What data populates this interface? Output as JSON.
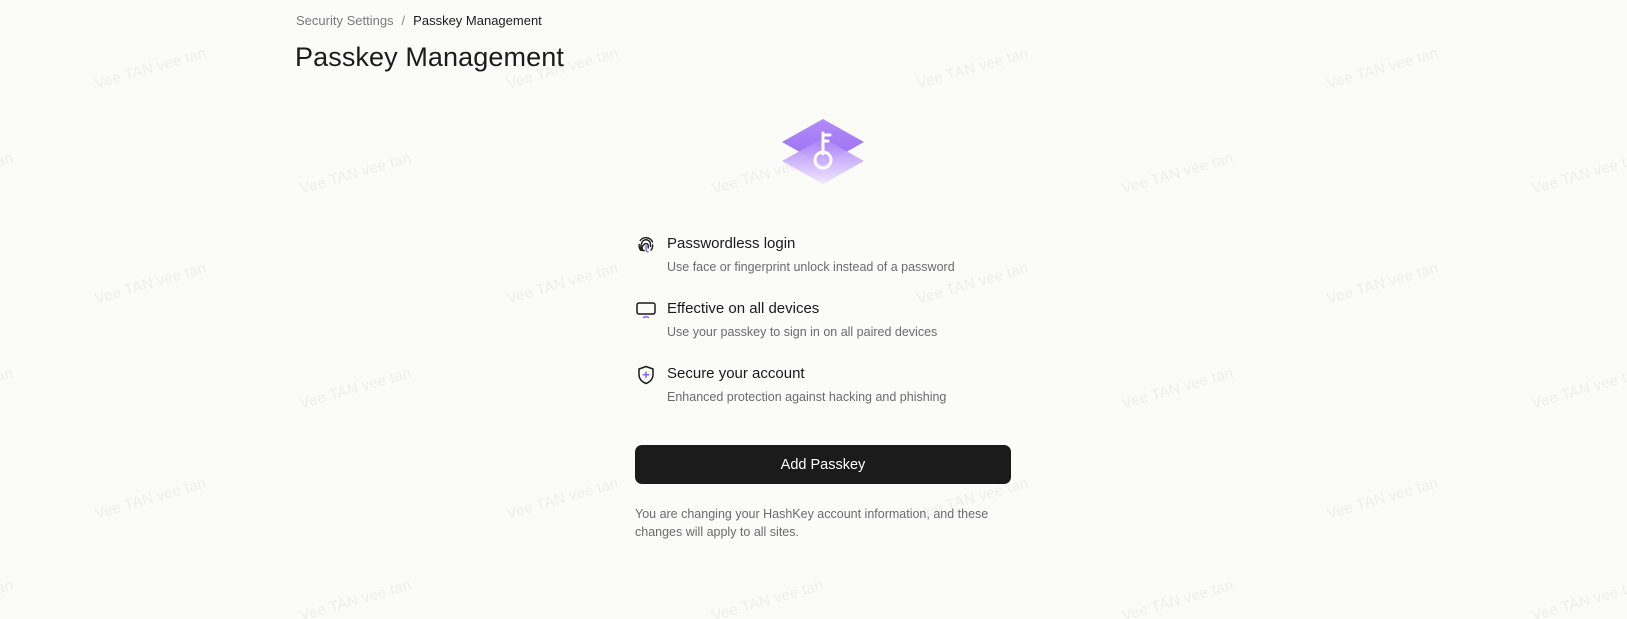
{
  "breadcrumb": {
    "parent": "Security Settings",
    "separator": "/",
    "current": "Passkey Management"
  },
  "page": {
    "title": "Passkey Management"
  },
  "hero": {
    "icon": "passkey-key-icon",
    "accent_color": "#a57cf6"
  },
  "features": [
    {
      "icon": "fingerprint-icon",
      "title": "Passwordless login",
      "description": "Use face or fingerprint unlock instead of a password"
    },
    {
      "icon": "devices-icon",
      "title": "Effective on all devices",
      "description": "Use your passkey to sign in on all paired devices"
    },
    {
      "icon": "shield-icon",
      "title": "Secure your account",
      "description": "Enhanced protection against hacking and phishing"
    }
  ],
  "actions": {
    "add_passkey_label": "Add Passkey"
  },
  "notice": "You are changing your HashKey account information, and these changes will apply to all sites.",
  "watermark": {
    "text": "Vee TAN vee tan"
  },
  "colors": {
    "background": "#fbfbf8",
    "primary_button": "#1b1b1b",
    "accent": "#8b5cf6"
  }
}
